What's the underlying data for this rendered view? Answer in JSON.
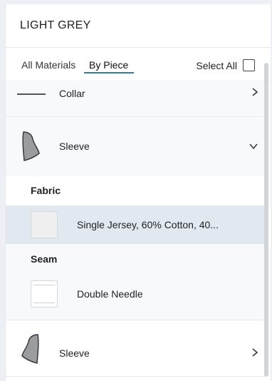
{
  "header": {
    "title": "LIGHT GREY"
  },
  "tabs": [
    {
      "label": "All Materials"
    },
    {
      "label": "By Piece"
    }
  ],
  "select_all": {
    "label": "Select All",
    "checked": false
  },
  "pieces": [
    {
      "label": "Collar",
      "icon": "collar-line-icon",
      "expanded": false
    },
    {
      "label": "Sleeve",
      "icon": "sleeve-piece-icon",
      "expanded": true,
      "sections": [
        {
          "heading": "Fabric",
          "items": [
            {
              "label": "Single Jersey, 60% Cotton, 40...",
              "selected": true
            }
          ]
        },
        {
          "heading": "Seam",
          "items": [
            {
              "label": "Double Needle",
              "selected": false
            }
          ]
        }
      ]
    },
    {
      "label": "Sleeve",
      "icon": "sleeve-piece-icon",
      "expanded": false
    }
  ],
  "colors": {
    "accent": "#2d7ea6",
    "selected_row": "#e2e8f0",
    "icon_fill": "#9a9ca0"
  }
}
